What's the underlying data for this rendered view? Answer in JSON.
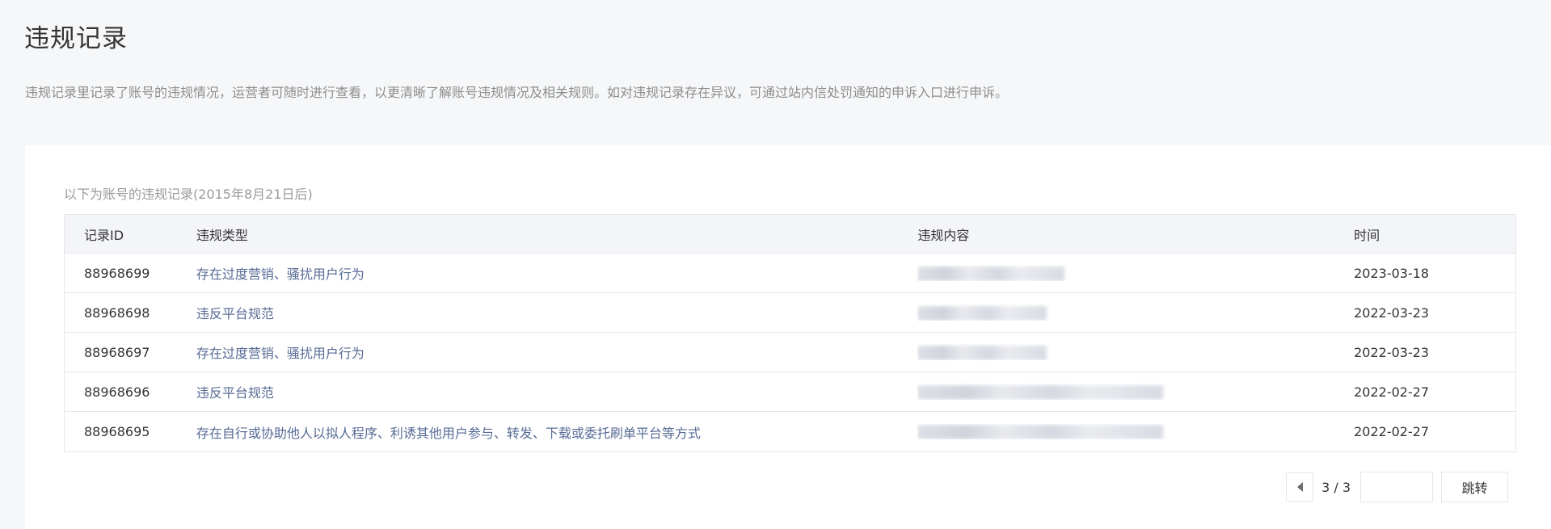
{
  "header": {
    "title": "违规记录",
    "description": "违规记录里记录了账号的违规情况，运营者可随时进行查看，以更清晰了解账号违规情况及相关规则。如对违规记录存在异议，可通过站内信处罚通知的申诉入口进行申诉。"
  },
  "panel": {
    "caption": "以下为账号的违规记录(2015年8月21日后)",
    "columns": [
      "记录ID",
      "违规类型",
      "违规内容",
      "时间"
    ],
    "rows": [
      {
        "id": "88968699",
        "type": "存在过度营销、骚扰用户行为",
        "time": "2023-03-18",
        "content_blur": 0.57
      },
      {
        "id": "88968698",
        "type": "违反平台规范",
        "time": "2022-03-23",
        "content_blur": 0.5
      },
      {
        "id": "88968697",
        "type": "存在过度营销、骚扰用户行为",
        "time": "2022-03-23",
        "content_blur": 0.5
      },
      {
        "id": "88968696",
        "type": "违反平台规范",
        "time": "2022-02-27",
        "content_blur": 0.95
      },
      {
        "id": "88968695",
        "type": "存在自行或协助他人以拟人程序、利诱其他用户参与、转发、下载或委托刷单平台等方式",
        "time": "2022-02-27",
        "content_blur": 0.95
      }
    ]
  },
  "pager": {
    "page_text": "3 / 3",
    "input_value": "",
    "go_label": "跳转"
  },
  "colors": {
    "link": "#576b95",
    "page_bg": "#f6f7f9",
    "border": "#e7e7eb"
  }
}
